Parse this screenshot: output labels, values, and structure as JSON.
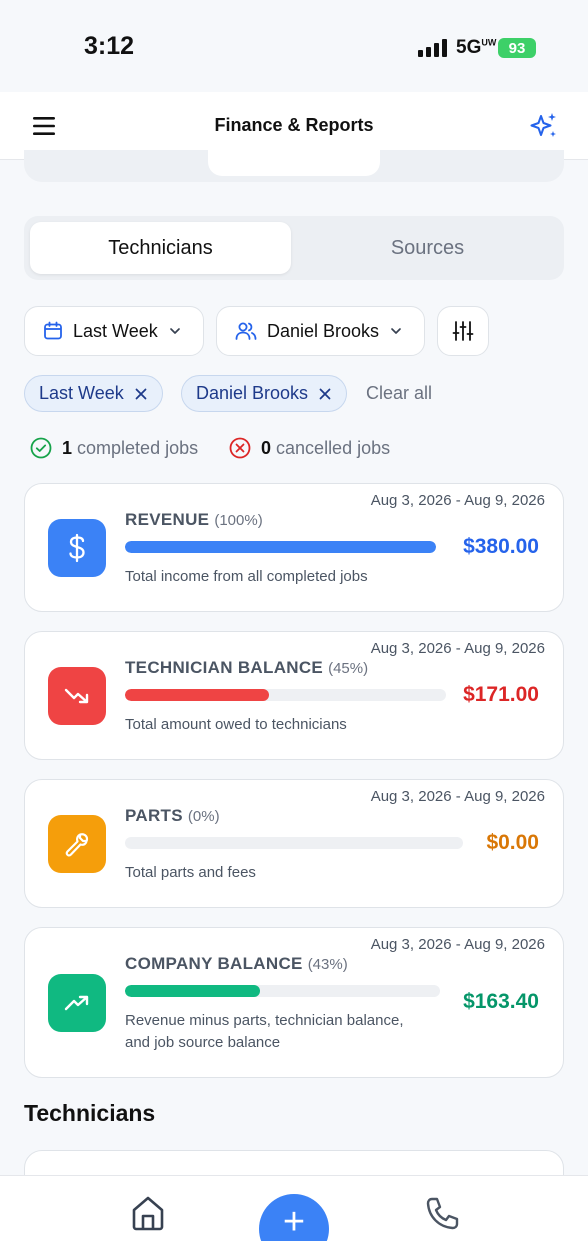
{
  "status_bar": {
    "time": "3:12",
    "network": "5GUW",
    "battery": "93"
  },
  "header": {
    "title": "Finance & Reports"
  },
  "segments": {
    "active": "Technicians",
    "inactive": "Sources"
  },
  "filters": {
    "date": "Last Week",
    "technician": "Daniel Brooks",
    "chips": [
      "Last Week",
      "Daniel Brooks"
    ],
    "clear_all": "Clear all"
  },
  "stats": {
    "completed_count": "1",
    "completed_label": "completed jobs",
    "cancelled_count": "0",
    "cancelled_label": "cancelled jobs"
  },
  "cards": [
    {
      "title": "REVENUE",
      "percent_label": "(100%)",
      "fill": 1.0,
      "date_range": "Aug 3, 2026 - Aug 9, 2026",
      "amount": "$380.00",
      "description": "Total income from all completed jobs",
      "color": "#3b82f6",
      "amount_color": "#2563eb",
      "icon": "dollar-icon"
    },
    {
      "title": "TECHNICIAN BALANCE",
      "percent_label": "(45%)",
      "fill": 0.45,
      "date_range": "Aug 3, 2026 - Aug 9, 2026",
      "amount": "$171.00",
      "description": "Total amount owed to technicians",
      "color": "#ef4444",
      "amount_color": "#dc2626",
      "icon": "trending-down-icon"
    },
    {
      "title": "PARTS",
      "percent_label": "(0%)",
      "fill": 0.0,
      "date_range": "Aug 3, 2026 - Aug 9, 2026",
      "amount": "$0.00",
      "description": "Total parts and fees",
      "color": "#f59e0b",
      "amount_color": "#d97706",
      "icon": "wrench-icon"
    },
    {
      "title": "COMPANY BALANCE",
      "percent_label": "(43%)",
      "fill": 0.43,
      "date_range": "Aug 3, 2026 - Aug 9, 2026",
      "amount": "$163.40",
      "description_line1": "Revenue minus parts, technician balance,",
      "description_line2": "and job source balance",
      "color": "#10b981",
      "amount_color": "#059669",
      "icon": "trending-up-icon"
    }
  ],
  "section_title": "Technicians",
  "nav": {
    "home_icon": "home-icon",
    "add_icon": "plus-icon",
    "phone_icon": "phone-icon"
  }
}
